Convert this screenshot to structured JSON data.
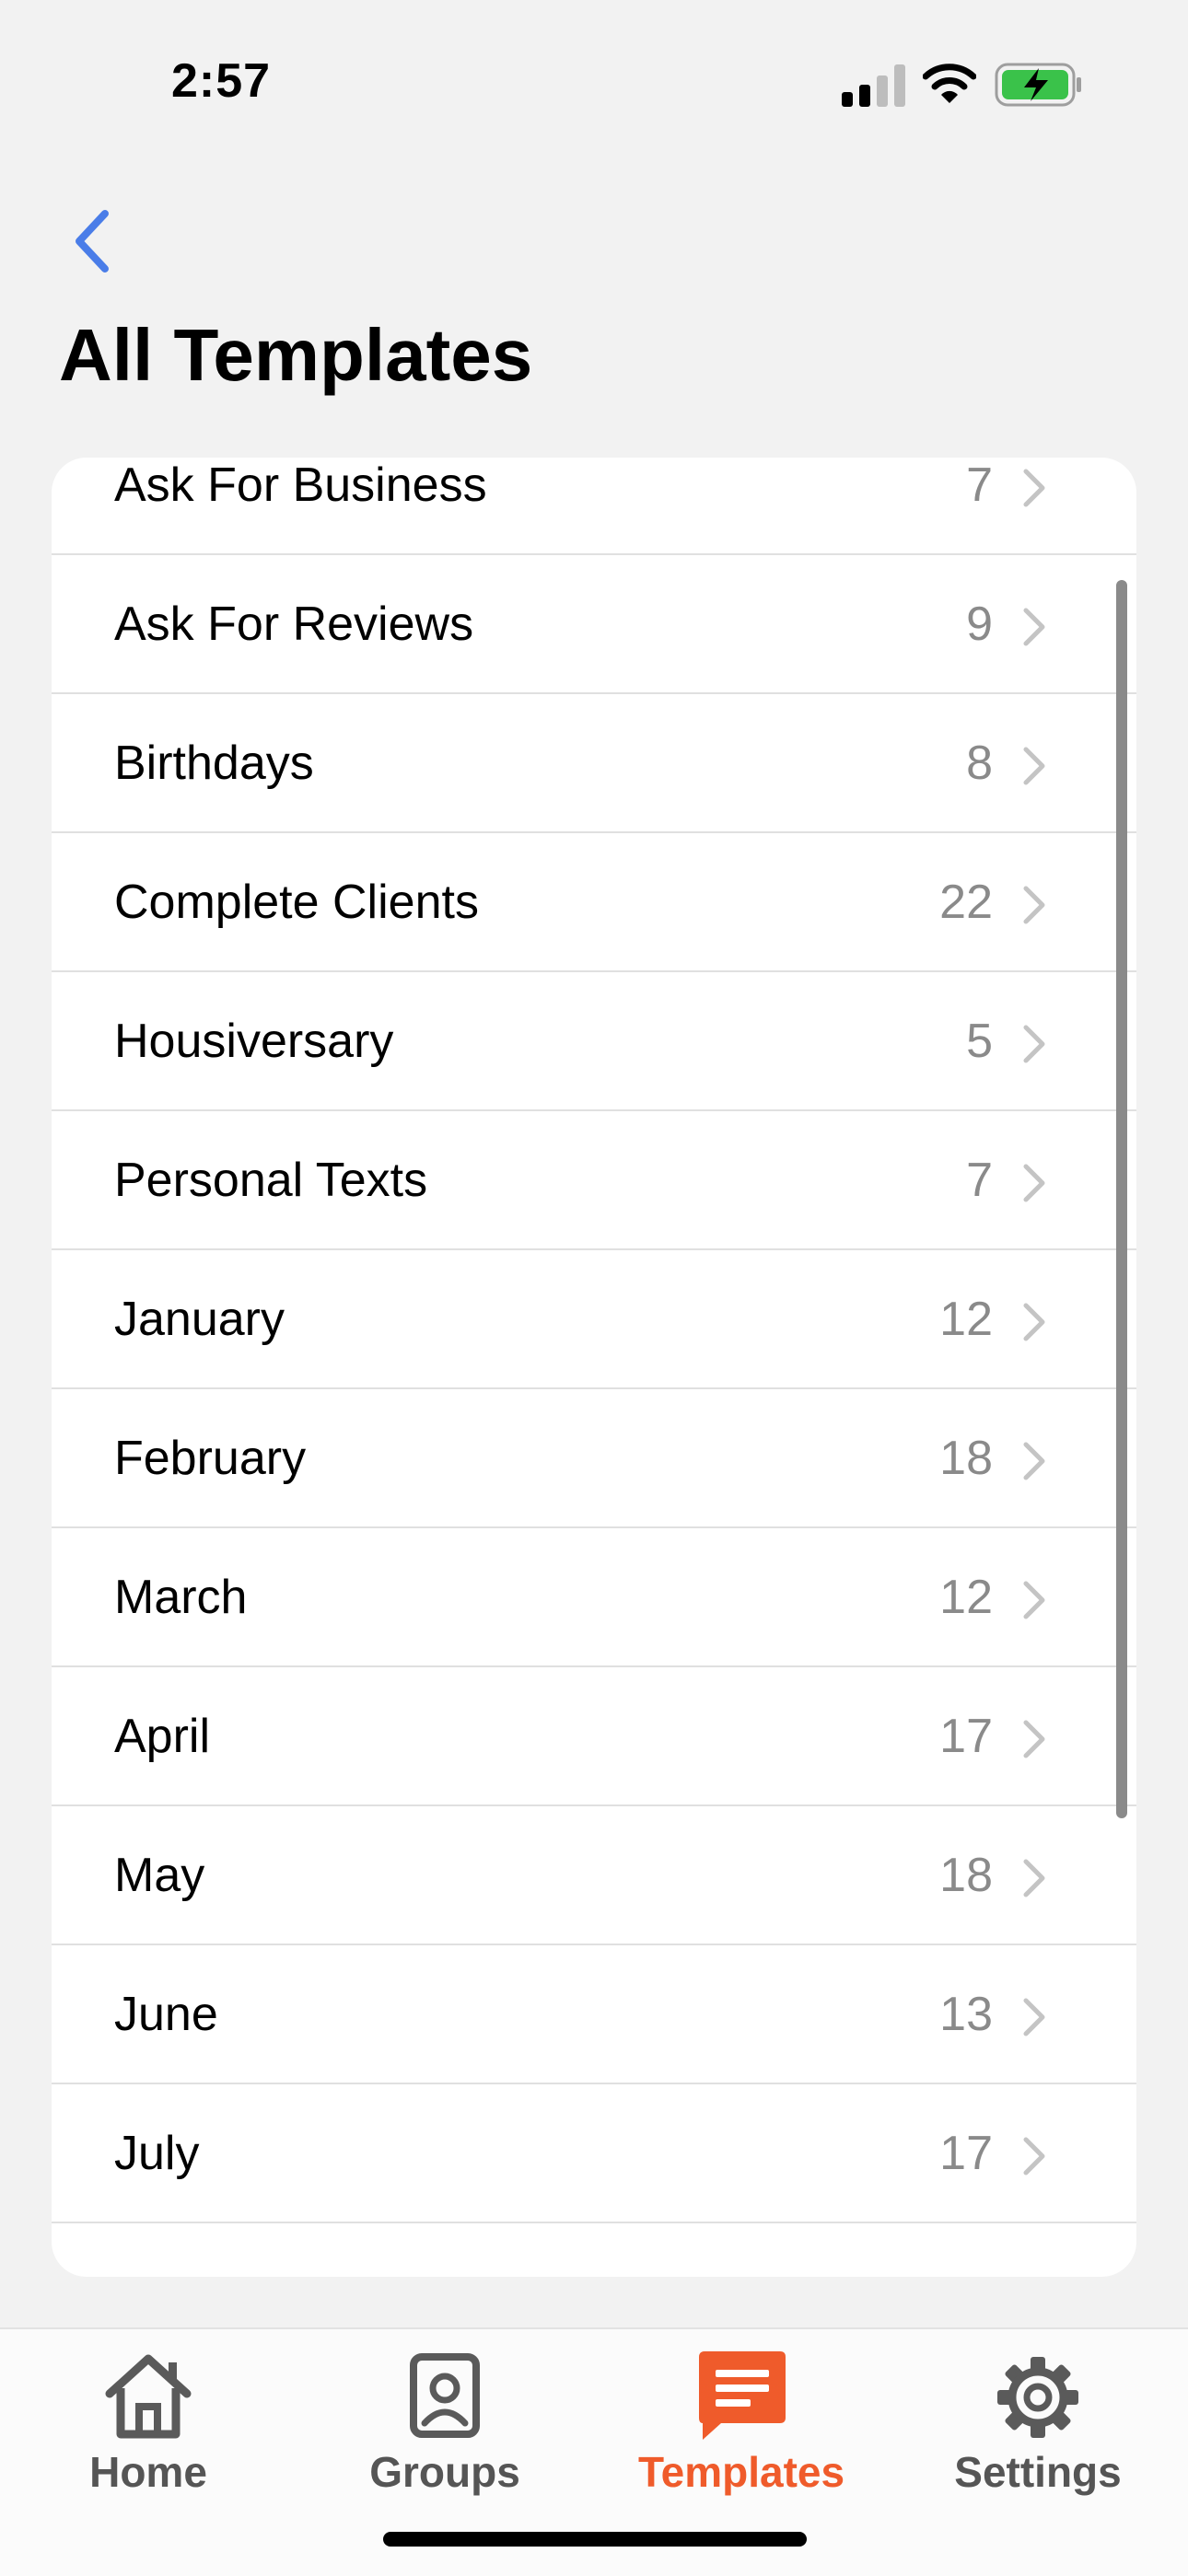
{
  "status_bar": {
    "time": "2:57"
  },
  "header": {
    "back_icon": "chevron-left-icon",
    "title": "All Templates"
  },
  "templates": [
    {
      "label": "Ask For Business",
      "count": "7"
    },
    {
      "label": "Ask For Reviews",
      "count": "9"
    },
    {
      "label": "Birthdays",
      "count": "8"
    },
    {
      "label": "Complete Clients",
      "count": "22"
    },
    {
      "label": "Housiversary",
      "count": "5"
    },
    {
      "label": "Personal Texts",
      "count": "7"
    },
    {
      "label": "January",
      "count": "12"
    },
    {
      "label": "February",
      "count": "18"
    },
    {
      "label": "March",
      "count": "12"
    },
    {
      "label": "April",
      "count": "17"
    },
    {
      "label": "May",
      "count": "18"
    },
    {
      "label": "June",
      "count": "13"
    },
    {
      "label": "July",
      "count": "17"
    }
  ],
  "tab_bar": {
    "tabs": [
      {
        "label": "Home",
        "icon": "home-icon"
      },
      {
        "label": "Groups",
        "icon": "contact-card-icon"
      },
      {
        "label": "Templates",
        "icon": "message-template-icon",
        "active": true
      },
      {
        "label": "Settings",
        "icon": "gear-icon"
      }
    ]
  },
  "colors": {
    "accent": "#ef5b2b",
    "back_arrow": "#4a7de8",
    "battery": "#3ac24a"
  }
}
